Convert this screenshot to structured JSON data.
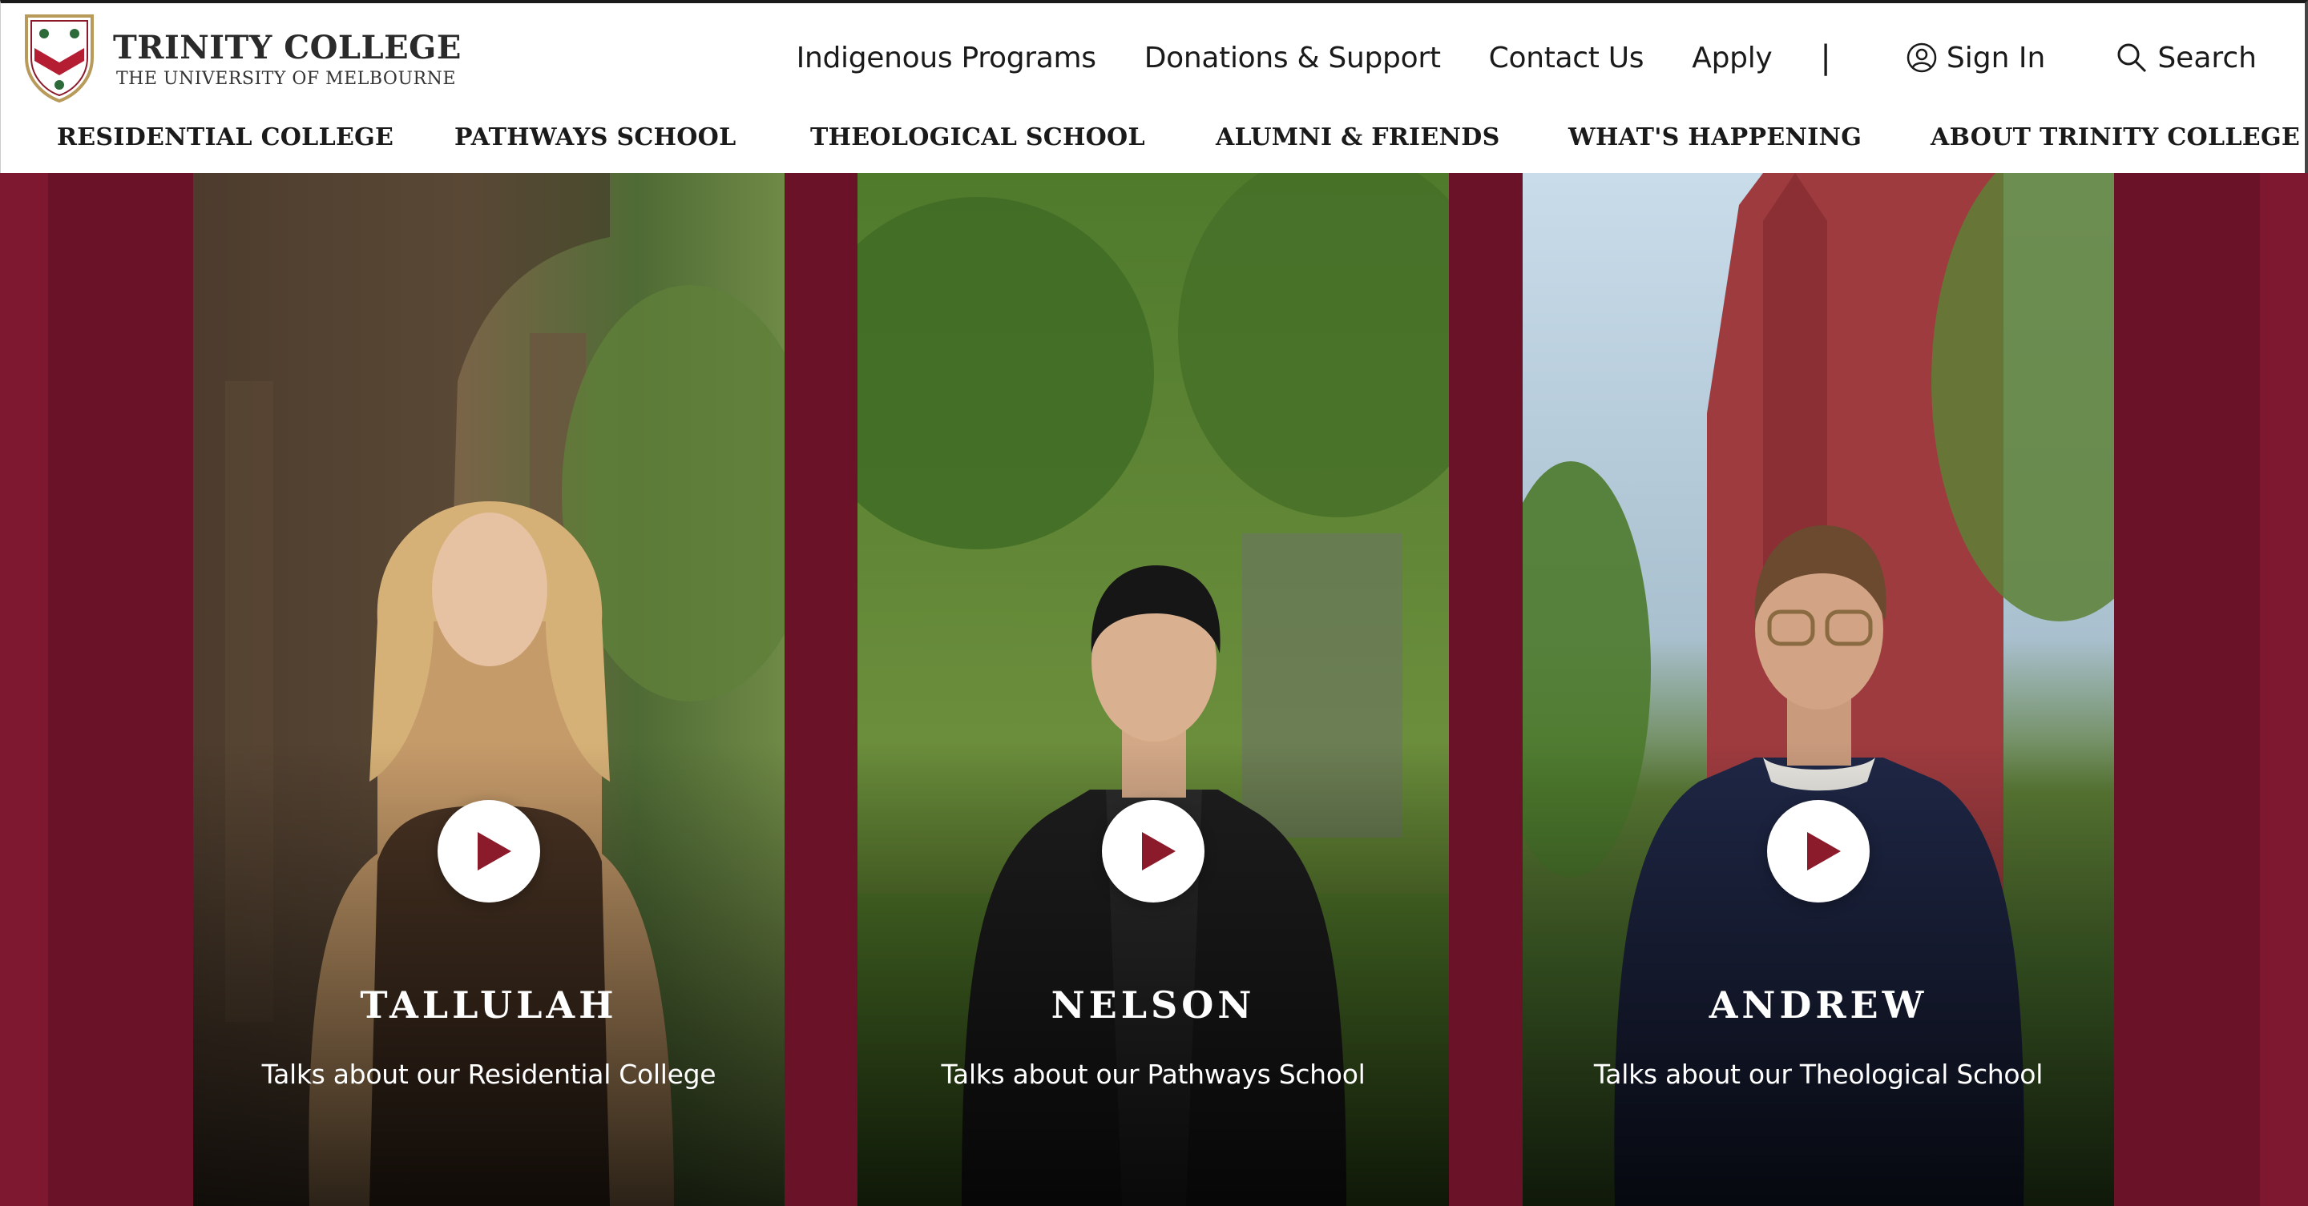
{
  "header": {
    "logo": {
      "title": "TRINITY COLLEGE",
      "subtitle": "THE UNIVERSITY OF MELBOURNE"
    },
    "utility_nav": {
      "indigenous": "Indigenous Programs",
      "donations": "Donations & Support",
      "contact": "Contact Us",
      "apply": "Apply",
      "divider": "|",
      "sign_in": "Sign In",
      "search": "Search"
    },
    "main_nav": [
      {
        "label": "RESIDENTIAL COLLEGE"
      },
      {
        "label": "PATHWAYS SCHOOL"
      },
      {
        "label": "THEOLOGICAL SCHOOL"
      },
      {
        "label": "ALUMNI & FRIENDS"
      },
      {
        "label": "WHAT'S HAPPENING"
      },
      {
        "label": "ABOUT TRINITY COLLEGE"
      }
    ]
  },
  "hero": {
    "cards": [
      {
        "name": "TALLULAH",
        "caption": "Talks about our Residential College",
        "icon": "play-icon"
      },
      {
        "name": "NELSON",
        "caption": "Talks about our Pathways School",
        "icon": "play-icon"
      },
      {
        "name": "ANDREW",
        "caption": "Talks about our Theological School",
        "icon": "play-icon"
      }
    ]
  },
  "colors": {
    "brand_maroon": "#6a1228",
    "play_icon": "#8b1a2b",
    "text_dark": "#1a1a1a"
  }
}
